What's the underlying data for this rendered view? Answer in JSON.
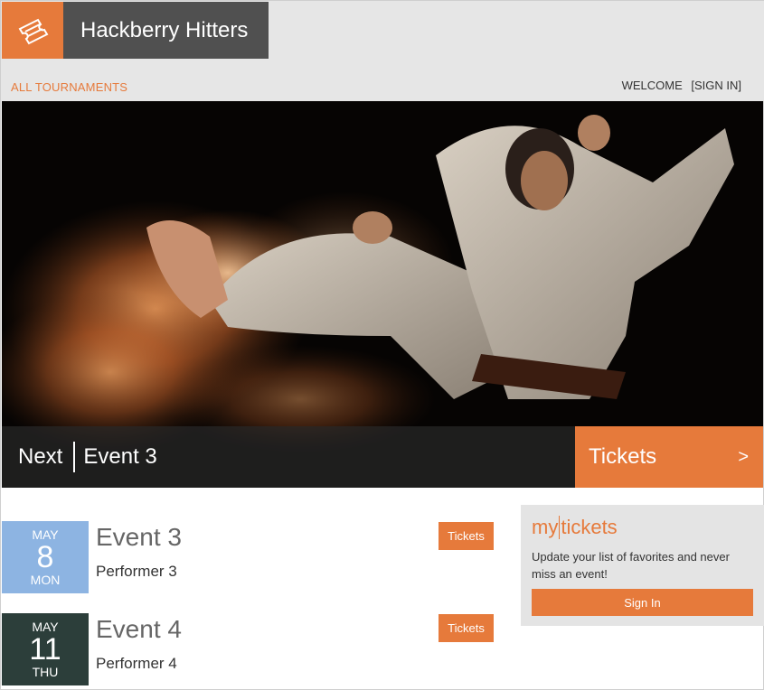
{
  "header": {
    "brand": "Hackberry Hitters",
    "logo_icon": "ticket-icon",
    "nav_all": "ALL TOURNAMENTS",
    "welcome": "WELCOME",
    "signin": "[SIGN IN]"
  },
  "hero": {
    "next_label": "Next",
    "event_title": "Event 3",
    "tickets_label": "Tickets",
    "arrow": ">"
  },
  "events": [
    {
      "month": "MAY",
      "day": "8",
      "weekday": "MON",
      "title": "Event 3",
      "performer": "Performer 3",
      "button": "Tickets",
      "date_color": "#8db4e2"
    },
    {
      "month": "MAY",
      "day": "11",
      "weekday": "THU",
      "title": "Event 4",
      "performer": "Performer 4",
      "button": "Tickets",
      "date_color": "#2c3e3a"
    }
  ],
  "mytickets": {
    "brand_left": "my",
    "brand_right": "tickets",
    "description": "Update your list of favorites and never miss an event!",
    "signin_label": "Sign In"
  },
  "colors": {
    "accent": "#e67a3b",
    "brand_bg": "#505050",
    "band": "#e6e6e6"
  }
}
